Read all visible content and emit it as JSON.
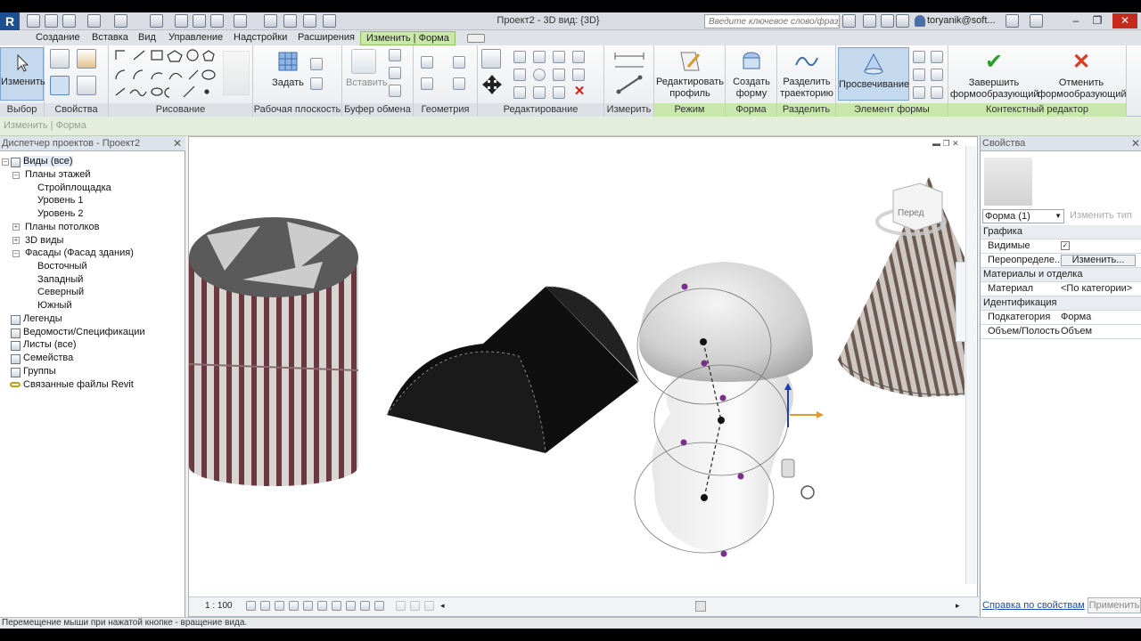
{
  "window": {
    "title": "Проект2 - 3D вид: {3D}",
    "search_placeholder": "Введите ключевое слово/фразу",
    "user": "toryanik@soft...",
    "app_button": "R"
  },
  "tabs": [
    {
      "label": "Создание"
    },
    {
      "label": "Вставка"
    },
    {
      "label": "Вид"
    },
    {
      "label": "Управление"
    },
    {
      "label": "Надстройки"
    },
    {
      "label": "Расширения"
    },
    {
      "label": "Изменить | Форма"
    }
  ],
  "ribbon": {
    "modify_label": "Изменить",
    "panels": {
      "select": "Выбор",
      "properties": "Свойства",
      "draw": "Рисование",
      "workplane": "Рабочая плоскость",
      "clipboard": "Буфер обмена",
      "geometry": "Геометрия",
      "modify": "Редактирование",
      "measure": "Измерить",
      "mode": "Режим",
      "form": "Форма",
      "divide": "Разделить",
      "form_element": "Элемент формы",
      "context_editor": "Контекстный редактор"
    },
    "set_label": "Задать",
    "paste_label": "Вставить",
    "edit_profile": "Редактировать профиль",
    "create_form": "Создать форму",
    "divide_path": "Разделить траекторию",
    "xray": "Просвечивание",
    "finish": "Завершить формообразующий",
    "cancel": "Отменить формообразующий"
  },
  "options_bar": "Изменить | Форма",
  "project_browser": {
    "title": "Диспетчер проектов - Проект2",
    "items": [
      {
        "label": "Виды (все)"
      },
      {
        "label": "Планы этажей"
      },
      {
        "label": "Стройплощадка"
      },
      {
        "label": "Уровень 1"
      },
      {
        "label": "Уровень 2"
      },
      {
        "label": "Планы потолков"
      },
      {
        "label": "3D виды"
      },
      {
        "label": "Фасады (Фасад здания)"
      },
      {
        "label": "Восточный"
      },
      {
        "label": "Западный"
      },
      {
        "label": "Северный"
      },
      {
        "label": "Южный"
      },
      {
        "label": "Легенды"
      },
      {
        "label": "Ведомости/Спецификации"
      },
      {
        "label": "Листы (все)"
      },
      {
        "label": "Семейства"
      },
      {
        "label": "Группы"
      },
      {
        "label": "Связанные файлы Revit"
      }
    ]
  },
  "view": {
    "scale": "1 : 100",
    "viewcube_label": "Перед"
  },
  "properties": {
    "title": "Свойства",
    "type_selector": "Форма (1)",
    "edit_type": "Изменить тип",
    "sections": {
      "graphics": "Графика",
      "materials": "Материалы и отделка",
      "identity": "Идентификация"
    },
    "rows": {
      "visible": "Видимые",
      "override": "Переопределе...",
      "override_btn": "Изменить...",
      "material": "Материал",
      "material_val": "<По категории>",
      "subcategory": "Подкатегория",
      "subcategory_val": "Форма",
      "solid_void": "Объем/Полость",
      "solid_void_val": "Объем"
    },
    "help_link": "Справка по свойствам",
    "apply_btn": "Применить"
  },
  "status_text": "Перемещение мыши при нажатой кнопке - вращение вида.",
  "colors": {
    "accent_tab": "#c8e7a8",
    "title_bar": "#d9dde3",
    "control_point": "#7a2f8a"
  }
}
